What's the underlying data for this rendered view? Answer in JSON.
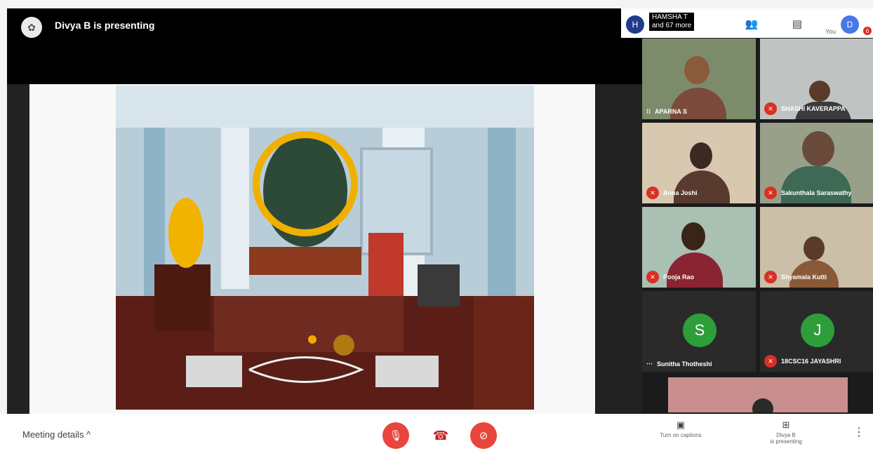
{
  "presenting": {
    "text": "Divya B is presenting"
  },
  "header": {
    "host_initial": "H",
    "host_name": "HAMSHA T",
    "host_more": "and 67 more",
    "you_label": "You",
    "you_initial": "D",
    "notif_count": "6"
  },
  "participants": [
    {
      "name": "APARNA S",
      "muted": false
    },
    {
      "name": "SHASHI KAVERAPPA",
      "muted": true
    },
    {
      "name": "Anna Joshi",
      "muted": true
    },
    {
      "name": "Sakunthala Saraswathy",
      "muted": true
    },
    {
      "name": "Pooja Rao",
      "muted": true
    },
    {
      "name": "Shyamala Kutti",
      "muted": true
    },
    {
      "name": "Sunitha Thotheshi",
      "muted": false,
      "initial": "S"
    },
    {
      "name": "18CSC16 JAYASHRI",
      "muted": true,
      "initial": "J"
    }
  ],
  "bottom": {
    "meeting_details": "Meeting details ^",
    "captions_label": "Turn on captions",
    "presenting_label_1": "Divya B",
    "presenting_label_2": "is presenting"
  },
  "colors": {
    "mute_red": "#d93025",
    "avatar_green": "#2e9e3a",
    "control_red": "#e8453c"
  }
}
